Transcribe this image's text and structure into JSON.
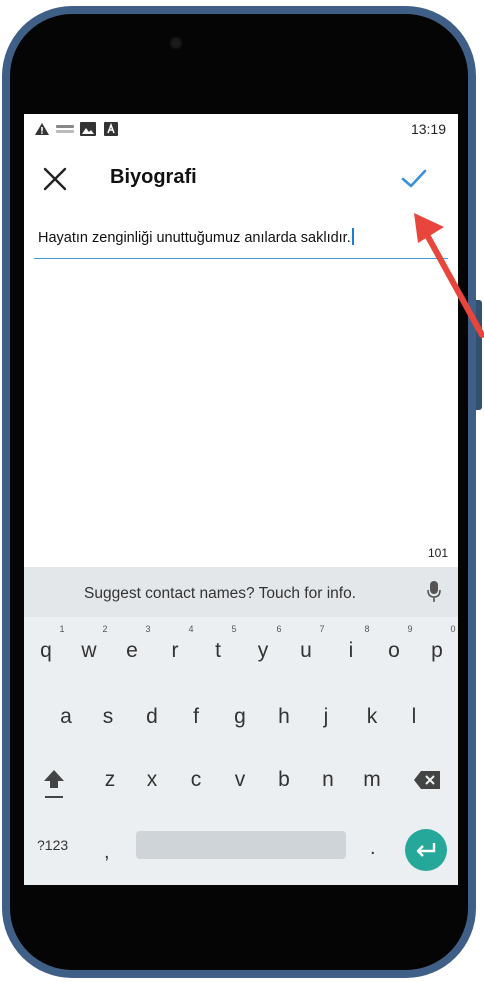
{
  "status_bar": {
    "time": "13:19",
    "icons": [
      "warning-icon",
      "cast-icon",
      "image-icon",
      "notification-icon"
    ]
  },
  "header": {
    "title": "Biyografi",
    "close_icon": "close-icon",
    "confirm_icon": "check-icon",
    "accent_color": "#3b8fd8"
  },
  "bio_field": {
    "value": "Hayatın zenginliği unuttuğumuz anılarda saklıdır."
  },
  "counter": "101",
  "keyboard": {
    "suggestion": "Suggest contact names? Touch for info.",
    "row1": [
      {
        "key": "q",
        "hint": "1"
      },
      {
        "key": "w",
        "hint": "2"
      },
      {
        "key": "e",
        "hint": "3"
      },
      {
        "key": "r",
        "hint": "4"
      },
      {
        "key": "t",
        "hint": "5"
      },
      {
        "key": "y",
        "hint": "6"
      },
      {
        "key": "u",
        "hint": "7"
      },
      {
        "key": "i",
        "hint": "8"
      },
      {
        "key": "o",
        "hint": "9"
      },
      {
        "key": "p",
        "hint": "0"
      }
    ],
    "row2": [
      "a",
      "s",
      "d",
      "f",
      "g",
      "h",
      "j",
      "k",
      "l"
    ],
    "row3": [
      "z",
      "x",
      "c",
      "v",
      "b",
      "n",
      "m"
    ],
    "symbols_label": "?123",
    "comma_label": ",",
    "period_label": ".",
    "enter_color": "#25a79a"
  },
  "annotation": {
    "arrow_color": "#e8453c"
  }
}
